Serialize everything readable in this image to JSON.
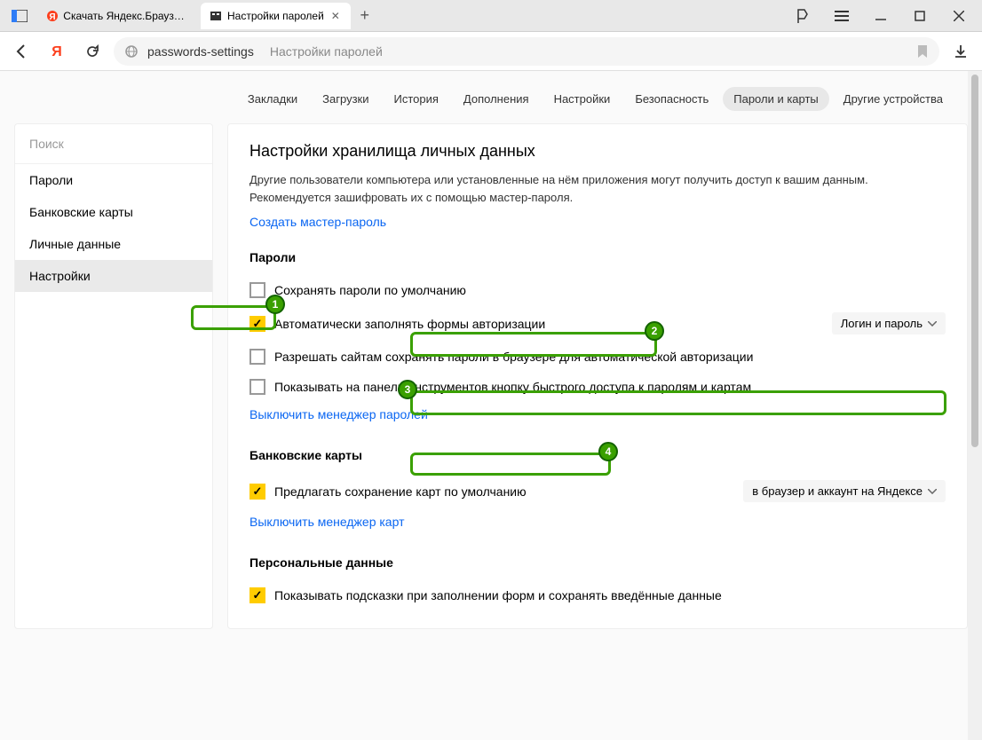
{
  "tabs": [
    {
      "title": "Скачать Яндекс.Браузер д",
      "icon": "yandex"
    },
    {
      "title": "Настройки паролей",
      "icon": "settings",
      "active": true
    }
  ],
  "address": {
    "path": "passwords-settings",
    "title": "Настройки паролей"
  },
  "topnav": [
    "Закладки",
    "Загрузки",
    "История",
    "Дополнения",
    "Настройки",
    "Безопасность",
    "Пароли и карты",
    "Другие устройства"
  ],
  "topnav_active": 6,
  "sidebar": {
    "search_placeholder": "Поиск",
    "items": [
      "Пароли",
      "Банковские карты",
      "Личные данные",
      "Настройки"
    ],
    "selected": 3
  },
  "panel": {
    "heading": "Настройки хранилища личных данных",
    "desc": "Другие пользователи компьютера или установленные на нём приложения могут получить доступ к вашим данным. Рекомендуется зашифровать их с помощью мастер-пароля.",
    "create_master": "Создать мастер-пароль",
    "sec_passwords": "Пароли",
    "opt_save_default": "Сохранять пароли по умолчанию",
    "opt_autofill": "Автоматически заполнять формы авторизации",
    "dd_login": "Логин и пароль",
    "opt_allow_sites": "Разрешать сайтам сохранять пароли в браузере для автоматической авторизации",
    "opt_show_toolbar": "Показывать на панели инструментов кнопку быстрого доступа к паролям и картам",
    "disable_pwd_mgr": "Выключить менеджер паролей",
    "sec_cards": "Банковские карты",
    "opt_offer_save_cards": "Предлагать сохранение карт по умолчанию",
    "dd_cards_dest": "в браузер и аккаунт на Яндексе",
    "disable_card_mgr": "Выключить менеджер карт",
    "sec_personal": "Персональные данные",
    "opt_show_hints": "Показывать подсказки при заполнении форм и сохранять введённые данные"
  },
  "checks": {
    "save_default": false,
    "autofill": true,
    "allow_sites": false,
    "show_toolbar": false,
    "offer_cards": true,
    "show_hints": true
  }
}
